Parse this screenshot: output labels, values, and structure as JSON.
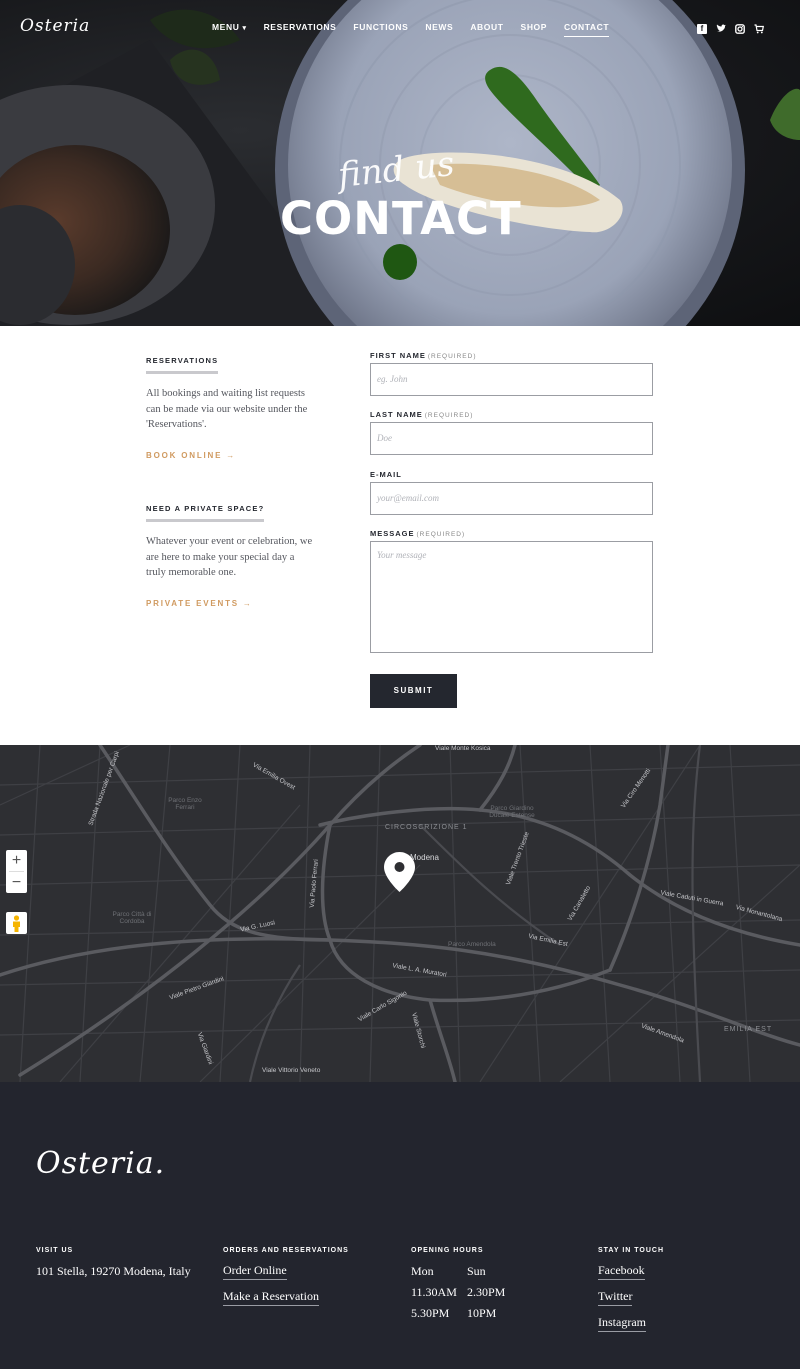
{
  "header": {
    "logo": "Osteria",
    "nav": [
      {
        "label": "Menu",
        "caret": "▾"
      },
      {
        "label": "Reservations"
      },
      {
        "label": "Functions"
      },
      {
        "label": "News"
      },
      {
        "label": "About"
      },
      {
        "label": "Shop"
      },
      {
        "label": "Contact",
        "active": true
      }
    ],
    "social_icons": [
      "facebook-icon",
      "twitter-icon",
      "instagram-icon",
      "cart-icon"
    ]
  },
  "hero": {
    "script_text": "find us",
    "title": "CONTACT"
  },
  "sidebar": {
    "reservations": {
      "heading": "Reservations",
      "text": "All bookings and waiting list requests can be made via our website under the 'Reservations'.",
      "link": "Book online →"
    },
    "private": {
      "heading": "Need a private space?",
      "text": "Whatever your event or celebration, we are here to make your special day a truly memorable one.",
      "link": "Private events →"
    }
  },
  "form": {
    "first_name": {
      "label": "First name",
      "required": "(Required)",
      "placeholder": "eg. John"
    },
    "last_name": {
      "label": "Last name",
      "required": "(Required)",
      "placeholder": "Doe"
    },
    "email": {
      "label": "E-mail",
      "placeholder": "your@email.com"
    },
    "message": {
      "label": "Message",
      "required": "(Required)",
      "placeholder": "Your message"
    },
    "submit": "Submit"
  },
  "map": {
    "zoom_in": "+",
    "zoom_out": "−",
    "district": "CIRCOSCRIZIONE 1",
    "district2": "EMILIA EST",
    "city": "Modena",
    "streets": {
      "s1": "Viale Monte Kosica",
      "s2": "Via Emilia Ovest",
      "s3": "Via G. Luosi",
      "s4": "Viale L. A. Muratori",
      "s5": "Via Emilia Est",
      "s6": "Viale Pietro Giardini",
      "s7": "Viale Vittorio Veneto",
      "s8": "Viale Carlo Sigonio",
      "s9": "Viale Storchi",
      "s10": "Strada Nazionale per Carpi",
      "s11": "Via Ciro Menotti",
      "s12": "Viale Caduti in Guerra",
      "s13": "Via Giardini",
      "s14": "Via Paolo Ferrari",
      "s15": "Viale Trento Trieste",
      "s16": "Via Canaletto",
      "s17": "Viale Amendola",
      "s18": "Via Nonantolana"
    },
    "parks": {
      "p1": "Parco Enzo Ferrari",
      "p2": "Parco Città di Cordoba",
      "p3": "Parco Giardino Ducale Estense",
      "p4": "Parco Amendola"
    }
  },
  "footer": {
    "logo": "Osteria.",
    "visit": {
      "heading": "Visit us",
      "address": "101 Stella, 19270 Modena, Italy"
    },
    "orders": {
      "heading": "Orders and reservations",
      "links": [
        "Order Online",
        "Make a Reservation"
      ]
    },
    "hours": {
      "heading": "Opening hours",
      "rows": [
        [
          "Mon",
          "Sun"
        ],
        [
          "11.30AM",
          "2.30PM"
        ],
        [
          "5.30PM",
          "10PM"
        ]
      ]
    },
    "social": {
      "heading": "Stay in touch",
      "links": [
        "Facebook",
        "Twitter",
        "Instagram"
      ]
    }
  }
}
